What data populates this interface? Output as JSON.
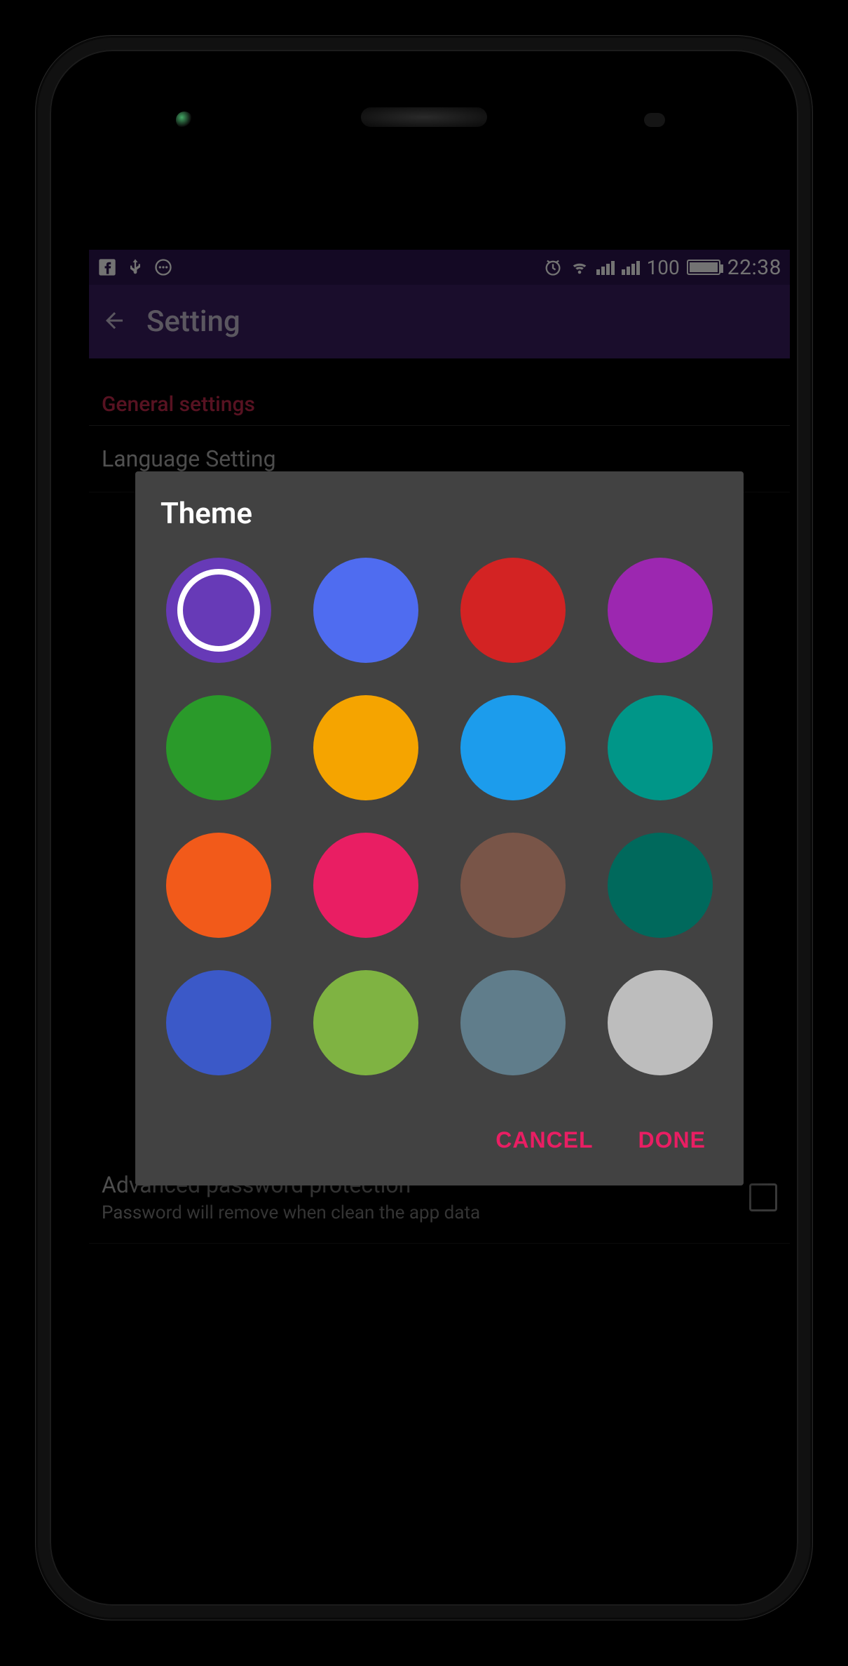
{
  "status_bar": {
    "icons_left": [
      "facebook",
      "usb",
      "more"
    ],
    "icons_right": [
      "alarm",
      "wifi",
      "signal",
      "signal",
      "battery"
    ],
    "battery_percent": "100",
    "time": "22:38"
  },
  "app_bar": {
    "title": "Setting"
  },
  "sections": {
    "general_header": "General settings",
    "language_title": "Language Setting",
    "adv_title": "Advanced password protection",
    "adv_sub": "Password will remove when clean the app data"
  },
  "dialog": {
    "title": "Theme",
    "actions": {
      "cancel": "CANCEL",
      "done": "DONE"
    },
    "swatches": [
      {
        "name": "deep-purple",
        "hex": "#673ab7",
        "selected": true
      },
      {
        "name": "indigo",
        "hex": "#4f6cf0",
        "selected": false
      },
      {
        "name": "red",
        "hex": "#d32323",
        "selected": false
      },
      {
        "name": "purple",
        "hex": "#9c27b0",
        "selected": false
      },
      {
        "name": "green",
        "hex": "#2a9a2a",
        "selected": false
      },
      {
        "name": "amber",
        "hex": "#f5a400",
        "selected": false
      },
      {
        "name": "light-blue",
        "hex": "#1c9cec",
        "selected": false
      },
      {
        "name": "teal",
        "hex": "#009688",
        "selected": false
      },
      {
        "name": "deep-orange",
        "hex": "#f25a1a",
        "selected": false
      },
      {
        "name": "pink",
        "hex": "#e91e63",
        "selected": false
      },
      {
        "name": "brown",
        "hex": "#795548",
        "selected": false
      },
      {
        "name": "teal-dark",
        "hex": "#00695c",
        "selected": false
      },
      {
        "name": "blue",
        "hex": "#3b59c8",
        "selected": false
      },
      {
        "name": "light-green",
        "hex": "#7fb342",
        "selected": false
      },
      {
        "name": "blue-grey",
        "hex": "#607d8b",
        "selected": false
      },
      {
        "name": "grey",
        "hex": "#bdbdbd",
        "selected": false
      }
    ]
  }
}
